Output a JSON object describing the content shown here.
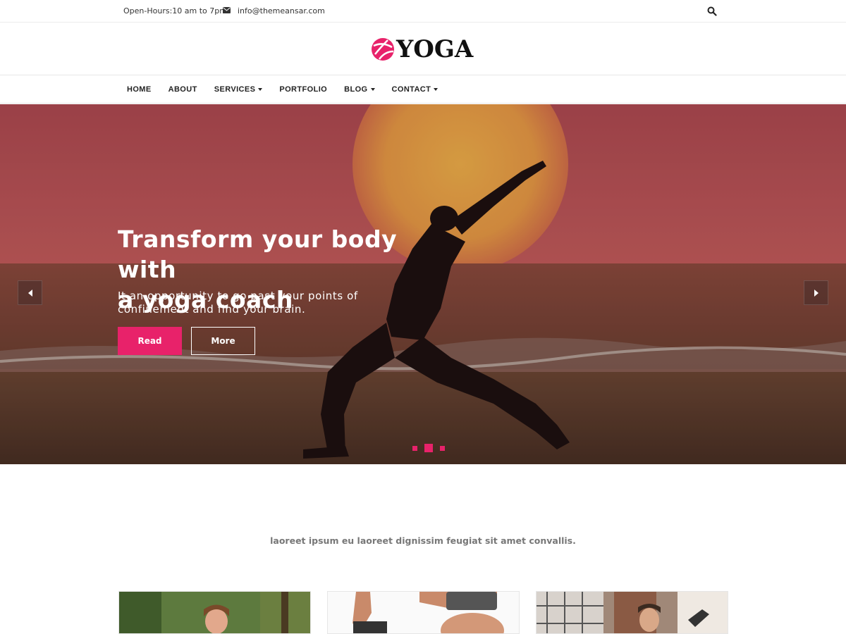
{
  "topbar": {
    "hours": "Open-Hours:10 am to 7pm",
    "email": "info@themeansar.com"
  },
  "logo": {
    "text": "YOGA"
  },
  "nav": {
    "items": [
      {
        "label": "HOME",
        "dropdown": false
      },
      {
        "label": "ABOUT",
        "dropdown": false
      },
      {
        "label": "SERVICES",
        "dropdown": true
      },
      {
        "label": "PORTFOLIO",
        "dropdown": false
      },
      {
        "label": "BLOG",
        "dropdown": true
      },
      {
        "label": "CONTACT",
        "dropdown": true
      }
    ]
  },
  "hero": {
    "title_line1": "Transform your body with",
    "title_line2": "a yoga coach",
    "subtitle_line1": "It an opportunity to go past your points of",
    "subtitle_line2": "confinement and find your brain.",
    "read_label": "Read",
    "more_label": "More",
    "slides_count": 3,
    "active_slide": 2
  },
  "tagline": "laoreet ipsum eu laoreet dignissim feugiat sit amet convallis.",
  "colors": {
    "accent": "#e8226a",
    "text": "#222222",
    "muted": "#777777"
  },
  "icons": {
    "search": "search-icon",
    "mail": "envelope-icon",
    "prev": "arrow-left-icon",
    "next": "arrow-right-icon"
  }
}
